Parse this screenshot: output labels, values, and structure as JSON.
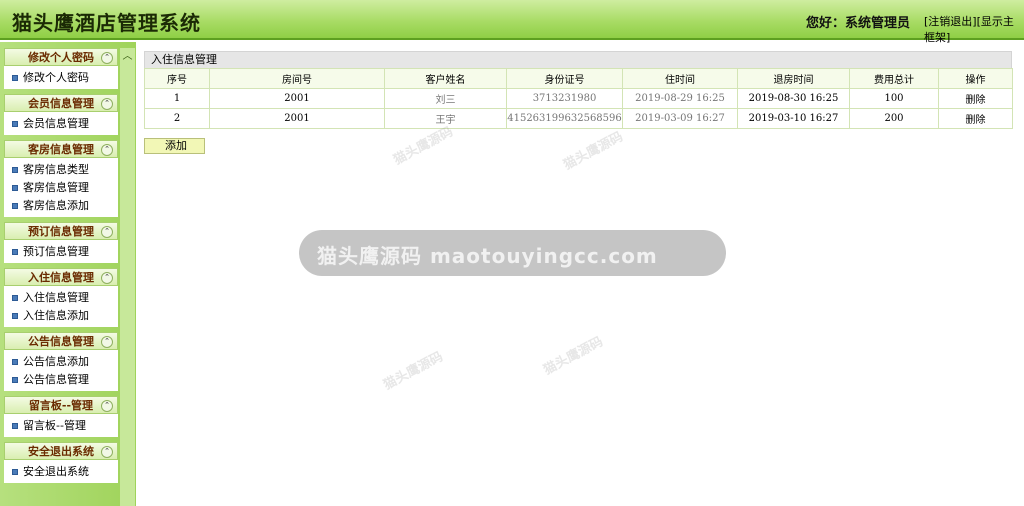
{
  "header": {
    "title": "猫头鹰酒店管理系统",
    "greeting": "您好：系统管理员",
    "logout_link": "[注销退出]",
    "main_frame_link": "[显示主框架]"
  },
  "sidebar": {
    "collapse_glyph": "⌃",
    "groups": [
      {
        "title": "修改个人密码",
        "items": [
          "修改个人密码"
        ]
      },
      {
        "title": "会员信息管理",
        "items": [
          "会员信息管理"
        ]
      },
      {
        "title": "客房信息管理",
        "items": [
          "客房信息类型",
          "客房信息管理",
          "客房信息添加"
        ]
      },
      {
        "title": "预订信息管理",
        "items": [
          "预订信息管理"
        ]
      },
      {
        "title": "入住信息管理",
        "items": [
          "入住信息管理",
          "入住信息添加"
        ]
      },
      {
        "title": "公告信息管理",
        "items": [
          "公告信息添加",
          "公告信息管理"
        ]
      },
      {
        "title": "留言板--管理",
        "items": [
          "留言板--管理"
        ]
      },
      {
        "title": "安全退出系统",
        "items": [
          "安全退出系统"
        ]
      }
    ]
  },
  "panel": {
    "title": "入住信息管理",
    "columns": [
      "序号",
      "房间号",
      "客户姓名",
      "身份证号",
      "住时间",
      "退房时间",
      "费用总计",
      "操作"
    ],
    "rows": [
      [
        "1",
        "2001",
        "刘三",
        "3713231980",
        "2019-08-29 16:25",
        "2019-08-30 16:25",
        "100",
        "删除"
      ],
      [
        "2",
        "2001",
        "王宇",
        "415263199632568596",
        "2019-03-09 16:27",
        "2019-03-10 16:27",
        "200",
        "删除"
      ]
    ],
    "add_label": "添加"
  },
  "watermark": {
    "banner": "猫头鹰源码 maotouyingcc.com",
    "tile": "猫头鹰源码"
  },
  "colors": {
    "header": "#a9dc66",
    "sidebar_strip": "#b6e07e",
    "group_title": "#6a2a00"
  }
}
